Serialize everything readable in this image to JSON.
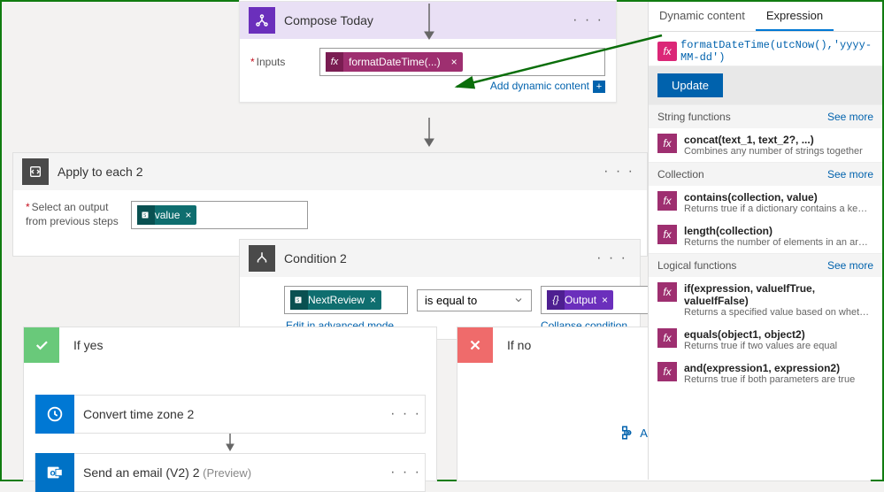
{
  "compose": {
    "title": "Compose Today",
    "inputs_label": "Inputs",
    "token": "formatDateTime(...)",
    "add_dc": "Add dynamic content"
  },
  "apply_each": {
    "title": "Apply to each 2",
    "select_label_1": "Select an output",
    "select_label_2": "from previous steps",
    "token": "value"
  },
  "condition": {
    "title": "Condition 2",
    "left_token": "NextReview",
    "op": "is equal to",
    "right_token": "Output",
    "edit_adv": "Edit in advanced mode",
    "collapse": "Collapse condition"
  },
  "branches": {
    "yes": "If yes",
    "no": "If no",
    "action1": "Convert time zone 2",
    "action2": "Send an email (V2) 2",
    "preview": " (Preview)",
    "add_action": "Add an action"
  },
  "expr": {
    "tab_dc": "Dynamic content",
    "tab_ex": "Expression",
    "code": "formatDateTime(utcNow(),'yyyy-MM-dd')",
    "update": "Update",
    "cats": {
      "string": "String functions",
      "collection": "Collection",
      "logical": "Logical functions",
      "see_more": "See more"
    },
    "fns": [
      {
        "sig": "concat(text_1, text_2?, ...)",
        "desc": "Combines any number of strings together"
      },
      {
        "sig": "contains(collection, value)",
        "desc": "Returns true if a dictionary contains a key, if an array con..."
      },
      {
        "sig": "length(collection)",
        "desc": "Returns the number of elements in an array or string"
      },
      {
        "sig": "if(expression, valueIfTrue, valueIfFalse)",
        "desc": "Returns a specified value based on whether the expressio..."
      },
      {
        "sig": "equals(object1, object2)",
        "desc": "Returns true if two values are equal"
      },
      {
        "sig": "and(expression1, expression2)",
        "desc": "Returns true if both parameters are true"
      }
    ]
  }
}
